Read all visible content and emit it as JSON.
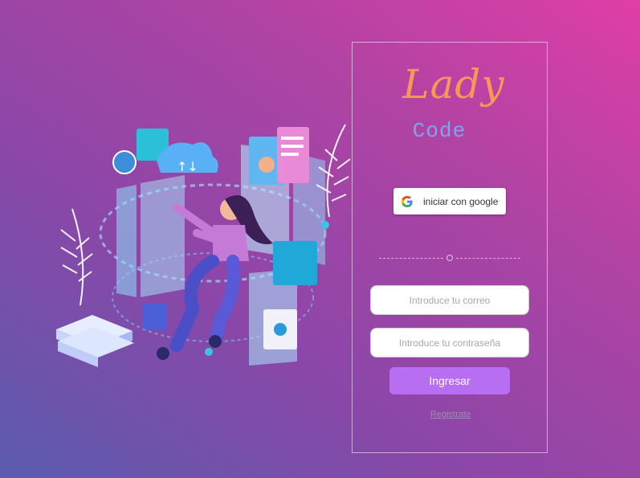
{
  "brand": {
    "name": "Lady",
    "sub": "Code"
  },
  "colors": {
    "accent": "#b86ef0",
    "logo_main": "#f39a55",
    "logo_sub": "#7fa4f0"
  },
  "login": {
    "google_label": "iniciar con google",
    "email_placeholder": "Introduce tu correo",
    "password_placeholder": "Introduce tu contraseña",
    "submit_label": "Ingresar",
    "register_label": "Registrate"
  },
  "icons": {
    "google": "google-g-icon",
    "divider": "divider-circle-icon"
  }
}
